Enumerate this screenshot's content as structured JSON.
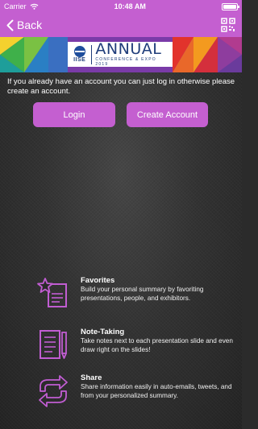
{
  "status_bar": {
    "carrier": "Carrier",
    "time": "10:48 AM"
  },
  "nav": {
    "back_label": "Back"
  },
  "banner": {
    "logo_org": "IISE",
    "logo_title": "ANNUAL",
    "logo_subtitle": "CONFERENCE & EXPO 2019"
  },
  "intro_text": "If you already have an account you can just log in otherwise please create an account.",
  "buttons": {
    "login": "Login",
    "create_account": "Create Account"
  },
  "features": [
    {
      "title": "Favorites",
      "description": "Build your personal summary by favoriting presentations, people, and exhibitors.",
      "icon": "favorites-icon"
    },
    {
      "title": "Note-Taking",
      "description": "Take notes next to each presentation slide and even draw right on the slides!",
      "icon": "note-taking-icon"
    },
    {
      "title": "Share",
      "description": "Share information easily in auto-emails, tweets, and from your personalized summary.",
      "icon": "share-icon"
    }
  ],
  "colors": {
    "accent": "#c45fd0",
    "icon_stroke": "#c15dd2"
  }
}
